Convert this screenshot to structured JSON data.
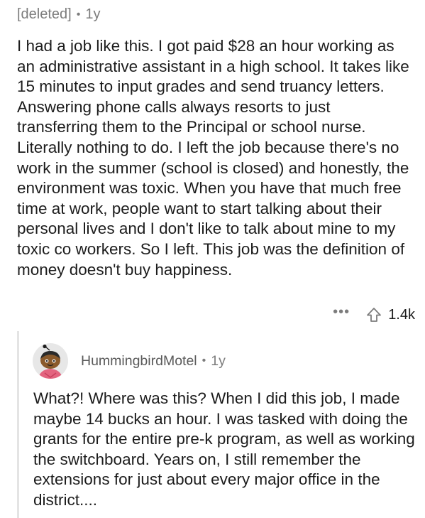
{
  "comment": {
    "author": "[deleted]",
    "separator": "•",
    "age": "1y",
    "body": "I had a job like this. I got paid $28 an hour working as an administrative assistant in a high school. It takes like 15 minutes to input grades and send truancy letters. Answering phone calls always resorts to just transferring them to the Principal or school nurse. Literally nothing to do. I left the job because there's no work in the summer (school is closed) and honestly, the environment was toxic. When you have that much free time at work, people want to start talking about their personal lives and I don't like to talk about mine to my toxic co workers. So I left. This job was the definition of money doesn't buy happiness.",
    "more_label": "•••",
    "upvote_icon": "upvote-arrow-icon",
    "vote_count": "1.4k"
  },
  "reply": {
    "author": "HummingbirdMotel",
    "separator": "•",
    "age": "1y",
    "avatar_icon": "snoo-avatar-icon",
    "body": "What?! Where was this? When I did this job, I made maybe 14 bucks an hour. I was tasked with doing the grants for the entire pre-k program, as well as working the switchboard. Years on, I still remember the extensions for just about every major office in the district...."
  },
  "colors": {
    "text": "#1c1c1c",
    "meta": "#7c7c7c",
    "thread_line": "#e4e4e4",
    "avatar_skin": "#8a5a2b",
    "avatar_bg": "#e7e7e7",
    "avatar_shirt": "#e3647f"
  }
}
